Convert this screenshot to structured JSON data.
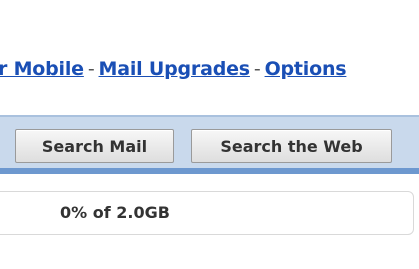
{
  "top_links": {
    "mobile_label": "r Mobile",
    "separator": "-",
    "mail_upgrades_label": "Mail Upgrades",
    "options_label": "Options"
  },
  "search_bar": {
    "search_mail_label": "Search Mail",
    "search_web_label": "Search the Web"
  },
  "storage": {
    "usage_text": "0% of 2.0GB"
  },
  "colors": {
    "link": "#1a4fb5",
    "search_bar_bg": "#c9d9ec",
    "search_bar_border": "#6d98cf"
  }
}
